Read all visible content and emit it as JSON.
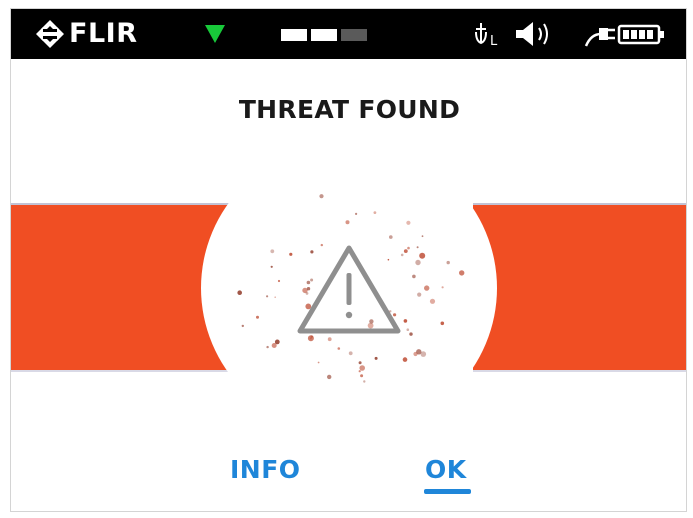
{
  "status_bar": {
    "brand": "FLIR",
    "signal_color": "#18c93a",
    "level": {
      "filled": 2,
      "total": 3
    },
    "icons": [
      "flir-logo-icon",
      "signal-triangle-icon",
      "antenna-icon",
      "speaker-icon",
      "power-plug-icon",
      "battery-icon"
    ],
    "antenna_label": "L"
  },
  "dialog": {
    "title": "THREAT FOUND",
    "icon": "warning-triangle-icon",
    "banner_color": "#f04e23"
  },
  "actions": {
    "info_label": "INFO",
    "ok_label": "OK",
    "selected": "OK",
    "accent_color": "#1f86d9"
  }
}
